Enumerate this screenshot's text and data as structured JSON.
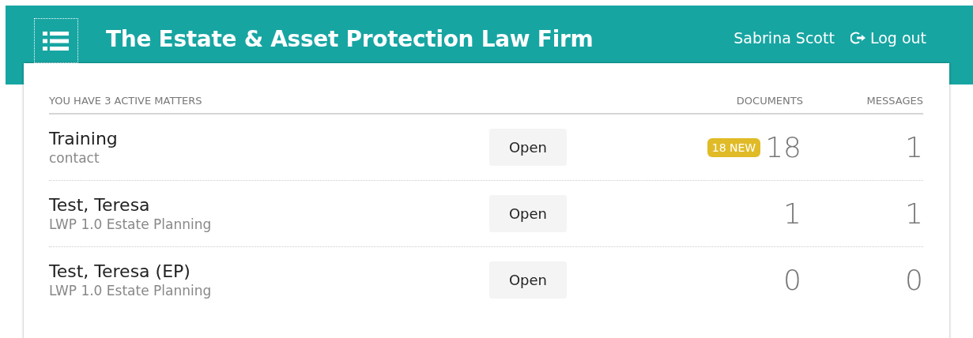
{
  "header": {
    "title": "The Estate & Asset Protection Law Firm",
    "user": "Sabrina Scott",
    "logout": "Log out"
  },
  "matters": {
    "heading": "YOU HAVE 3 ACTIVE MATTERS",
    "columns": [
      "DOCUMENTS",
      "MESSAGES"
    ],
    "rows": [
      {
        "name": "Training",
        "type": "contact",
        "action": "Open",
        "new_badge": "18 NEW",
        "documents": "18",
        "messages": "1"
      },
      {
        "name": "Test, Teresa",
        "type": "LWP 1.0 Estate Planning",
        "action": "Open",
        "documents": "1",
        "messages": "1"
      },
      {
        "name": "Test, Teresa (EP)",
        "type": "LWP 1.0 Estate Planning",
        "action": "Open",
        "documents": "0",
        "messages": "0"
      }
    ]
  }
}
